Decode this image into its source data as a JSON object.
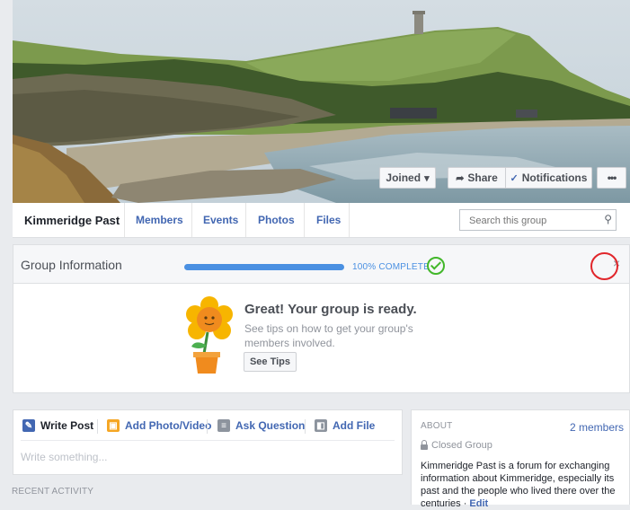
{
  "cover": {
    "joined_label": "Joined",
    "share_label": "Share",
    "notifications_label": "Notifications",
    "more_label": "•••",
    "icons": {
      "share": "share-arrow-icon",
      "notifications": "check-icon",
      "joined": "caret-down-icon"
    }
  },
  "tabs": {
    "group_name": "Kimmeridge Past",
    "items": [
      "Members",
      "Events",
      "Photos",
      "Files"
    ],
    "search_placeholder": "Search this group"
  },
  "group_info": {
    "title": "Group Information",
    "progress_percent": 100,
    "progress_label": "100% COMPLETE",
    "close_label": "×",
    "ready_title": "Great! Your group is ready.",
    "ready_text": "See tips on how to get your group's members involved.",
    "tips_button": "See Tips"
  },
  "composer": {
    "tabs": [
      "Write Post",
      "Add Photo/Video",
      "Ask Question",
      "Add File"
    ],
    "placeholder": "Write something..."
  },
  "recent_activity": "RECENT ACTIVITY",
  "about": {
    "heading": "ABOUT",
    "members": "2 members",
    "privacy": "Closed Group",
    "description": "Kimmeridge Past is a forum for exchanging information about Kimmeridge, especially its past and the people who lived there over the centuries · ",
    "edit_label": "Edit"
  },
  "colors": {
    "link": "#4267b2",
    "progress": "#4a90e2",
    "success": "#42b72a",
    "highlight_ring": "#e1262b"
  }
}
